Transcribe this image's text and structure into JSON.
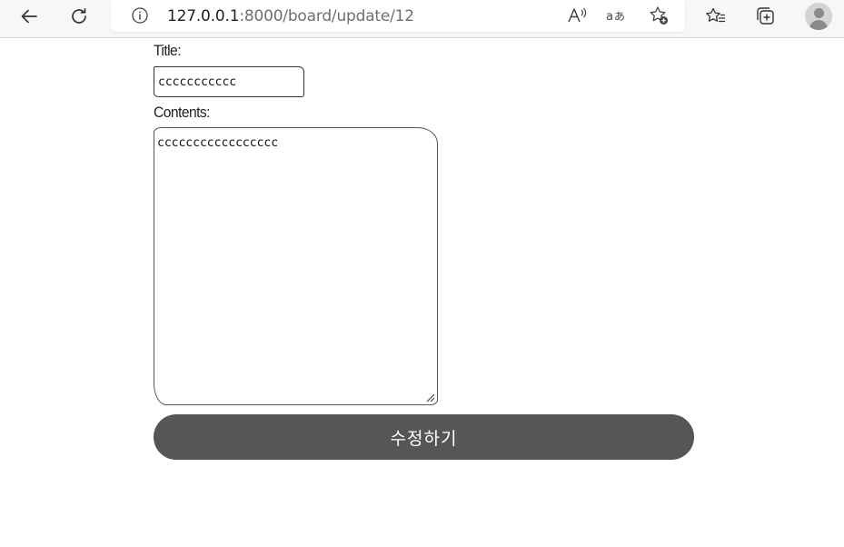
{
  "browser": {
    "url_host": "127.0.0.1",
    "url_rest": ":8000/board/update/12"
  },
  "form": {
    "title_label": "Title:",
    "title_value": "ccccccccccc",
    "contents_label": "Contents:",
    "contents_value": "ccccccccccccccccc",
    "submit_label": "수정하기"
  },
  "colors": {
    "submit_bg": "#565656",
    "toolbar_bg": "#f7f7f7"
  }
}
